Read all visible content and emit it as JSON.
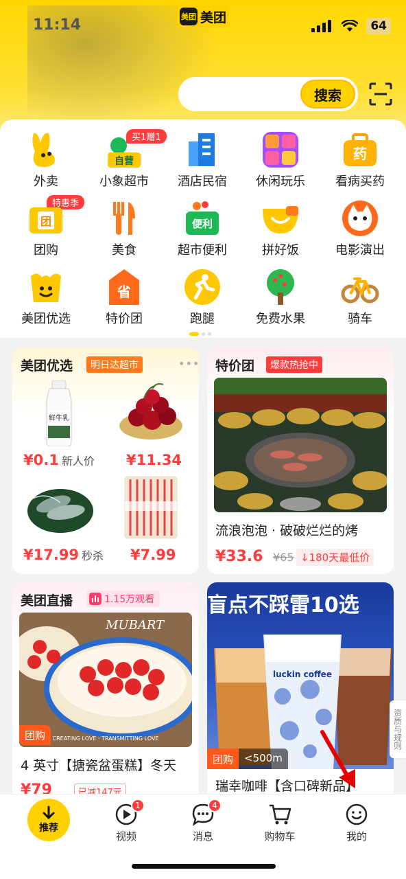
{
  "status": {
    "time": "11:14",
    "battery": "64"
  },
  "brand": {
    "mark": "美团",
    "name": "美团"
  },
  "search": {
    "button": "搜索"
  },
  "categories": [
    {
      "label": "外卖",
      "icon": "waimai-icon"
    },
    {
      "label": "小象超市",
      "icon": "xiaoxiang-icon",
      "icon_text": "自营",
      "badge": "买1赠1"
    },
    {
      "label": "酒店民宿",
      "icon": "hotel-icon"
    },
    {
      "label": "休闲玩乐",
      "icon": "leisure-icon"
    },
    {
      "label": "看病买药",
      "icon": "medicine-icon",
      "icon_text": "药"
    },
    {
      "label": "团购",
      "icon": "tuangou-icon",
      "icon_text": "团",
      "badge": "特惠季"
    },
    {
      "label": "美食",
      "icon": "food-icon"
    },
    {
      "label": "超市便利",
      "icon": "supermarket-icon",
      "icon_text": "便利"
    },
    {
      "label": "拼好饭",
      "icon": "pinhaofan-icon"
    },
    {
      "label": "电影演出",
      "icon": "movie-icon"
    },
    {
      "label": "美团优选",
      "icon": "youxuan-icon"
    },
    {
      "label": "特价团",
      "icon": "tejiatuan-icon",
      "icon_text": "省"
    },
    {
      "label": "跑腿",
      "icon": "paotui-icon"
    },
    {
      "label": "免费水果",
      "icon": "fruit-icon"
    },
    {
      "label": "骑车",
      "icon": "bike-icon"
    }
  ],
  "youxuan": {
    "title": "美团优选",
    "tag": "明日达超市",
    "more": "•••",
    "items": [
      {
        "price": "¥0.1",
        "note": "新人价",
        "bottle_text": "鲜牛乳"
      },
      {
        "price": "¥11.34",
        "note": ""
      },
      {
        "price": "¥17.99",
        "note": "秒杀"
      },
      {
        "price": "¥7.99",
        "note": ""
      }
    ]
  },
  "tejiatuan": {
    "title": "特价团",
    "tag": "爆款热抢中",
    "deal_title": "流浪泡泡 · 破破烂烂的烤",
    "price": "¥33.6",
    "original_price": "¥65",
    "lowest": "180天最低价"
  },
  "live": {
    "title": "美团直播",
    "viewers": "1.15万观看",
    "image_text": "MUBART",
    "caption": "CREATING LOVE · TRANSMITTING LOVE",
    "tag": "团购",
    "deal_title": "4 英寸【搪瓷盆蛋糕】冬天",
    "price": "¥79",
    "discount": "已减147元"
  },
  "coffee": {
    "banner": "盲点不踩雷10选",
    "cup_text": "luckin coffee",
    "tag": "团购",
    "distance": "<500m",
    "deal_title": "瑞幸咖啡【含口碑新品】"
  },
  "side_tab": "资质与规则",
  "nav": [
    {
      "label": "推荐",
      "icon": "arrow-down-icon"
    },
    {
      "label": "视频",
      "icon": "video-icon",
      "badge": "1"
    },
    {
      "label": "消息",
      "icon": "message-icon",
      "badge": "4"
    },
    {
      "label": "购物车",
      "icon": "cart-icon"
    },
    {
      "label": "我的",
      "icon": "profile-icon"
    }
  ],
  "colors": {
    "brand": "#ffd100",
    "price": "#ff3b3b",
    "accent": "#ff7a1a"
  }
}
